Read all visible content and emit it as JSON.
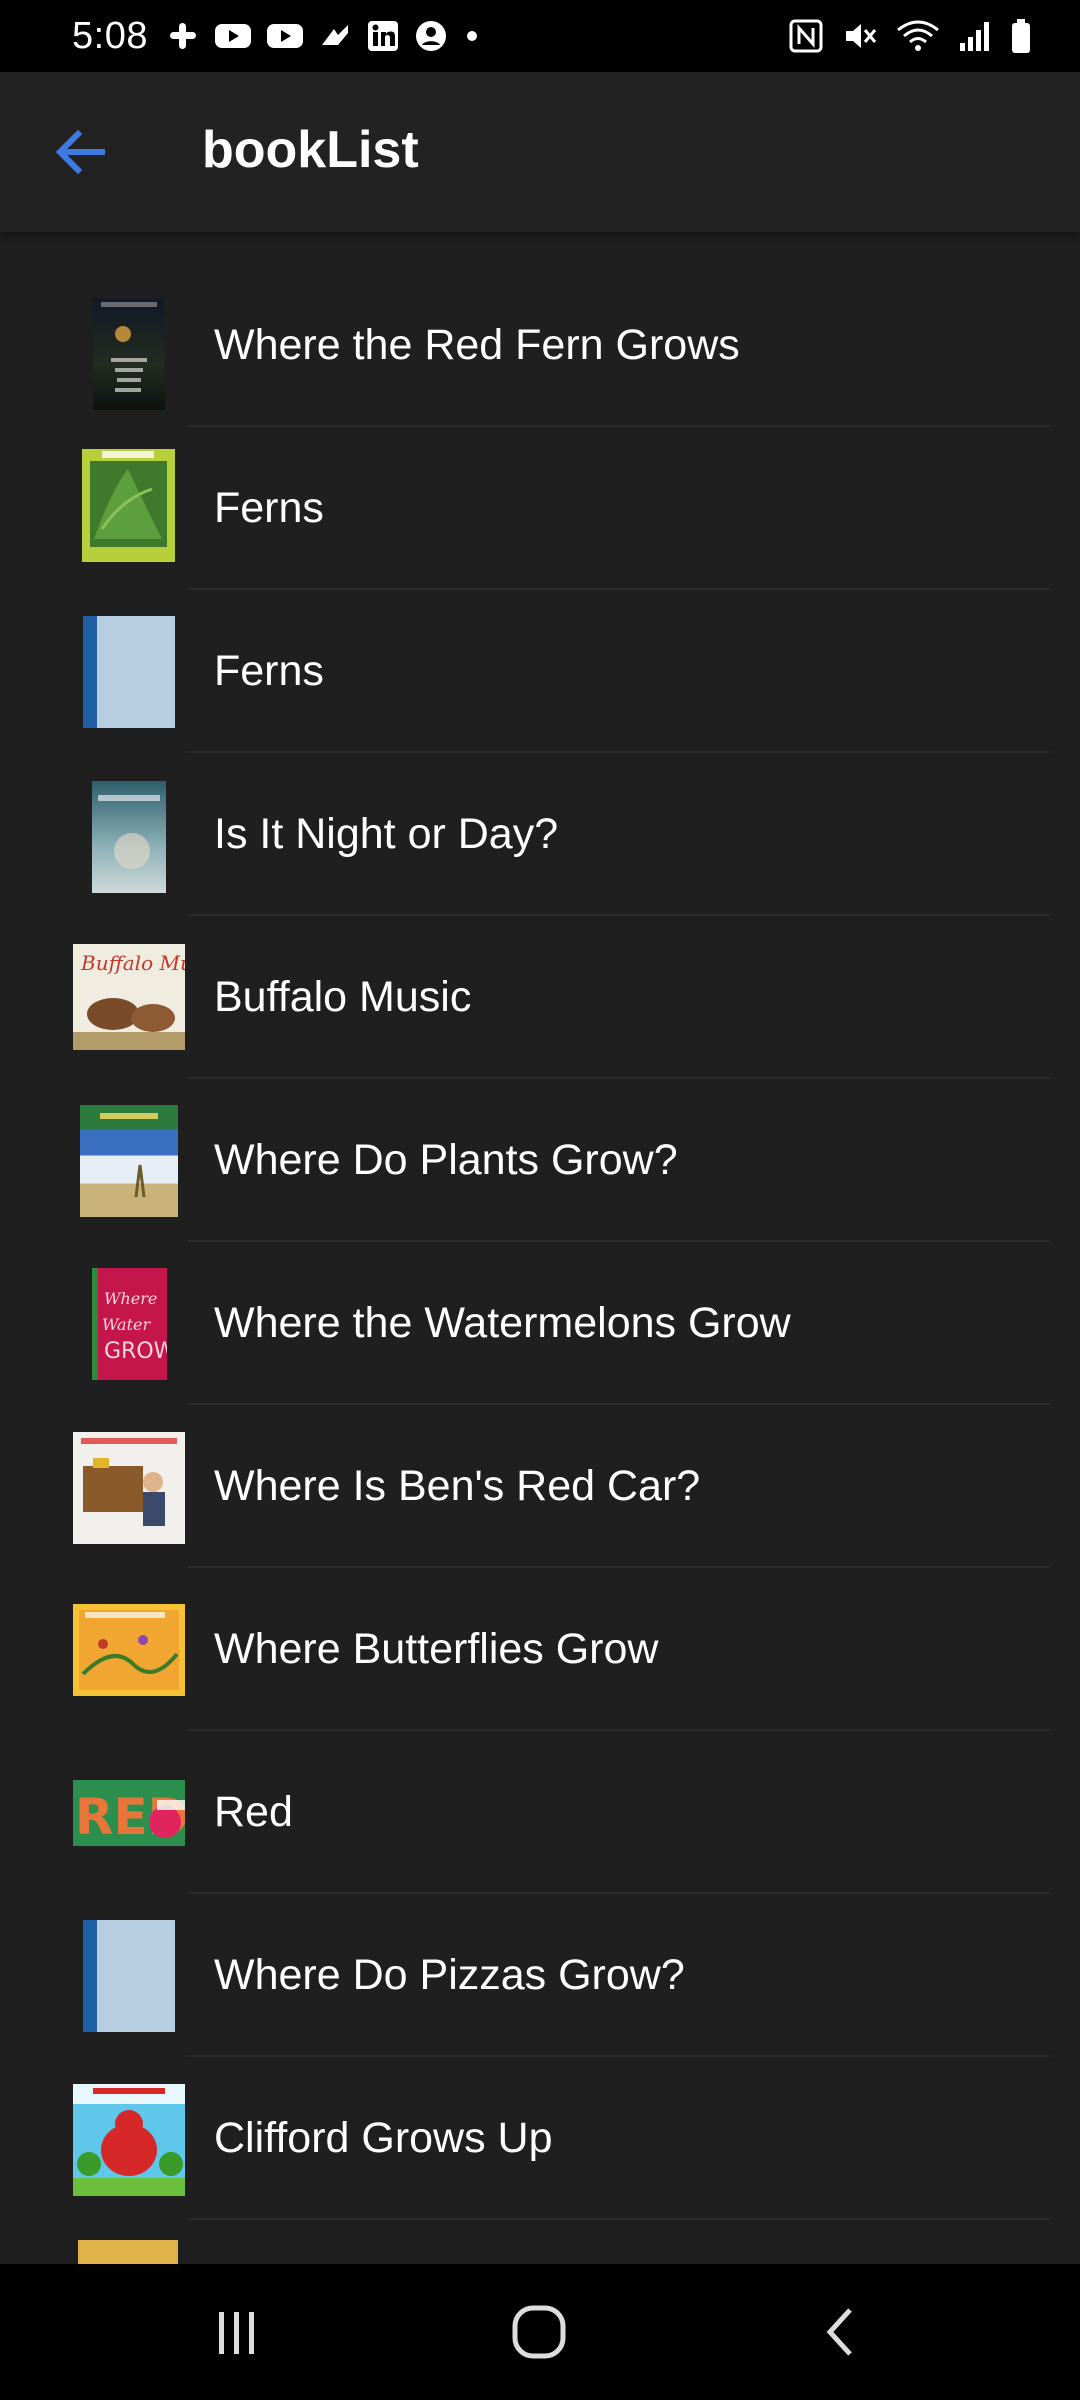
{
  "status_bar": {
    "time": "5:08",
    "left_icons": [
      "slack-icon",
      "youtube-icon",
      "youtube-icon",
      "notification-icon",
      "linkedin-icon",
      "account-icon",
      "dot-icon"
    ],
    "right_icons": [
      "nfc-icon",
      "mute-icon",
      "wifi-icon",
      "signal-icon",
      "battery-icon"
    ]
  },
  "app_bar": {
    "title": "bookList",
    "back_icon": "arrow-left-icon",
    "accent_color": "#3d7be0"
  },
  "books": [
    {
      "title": "Where the Red Fern Grows",
      "cover": "dark night scene cover"
    },
    {
      "title": "Ferns",
      "cover": "green fern leaves cover"
    },
    {
      "title": "Ferns",
      "cover": "placeholder blue cover"
    },
    {
      "title": "Is It Night or Day?",
      "cover": "teal photo cover"
    },
    {
      "title": "Buffalo Music",
      "cover": "illustrated buffalo cover"
    },
    {
      "title": "Where Do Plants Grow?",
      "cover": "beach plants cover"
    },
    {
      "title": "Where the Watermelons Grow",
      "cover": "pink watermelon cover"
    },
    {
      "title": "Where Is Ben's Red Car?",
      "cover": "boy with toy box cover"
    },
    {
      "title": "Where Butterflies Grow",
      "cover": "yellow butterflies cover"
    },
    {
      "title": "Red",
      "cover": "green red crayon cover"
    },
    {
      "title": "Where Do Pizzas Grow?",
      "cover": "placeholder blue cover"
    },
    {
      "title": "Clifford Grows Up",
      "cover": "clifford red dog cover"
    }
  ],
  "nav_bar": {
    "recents_icon": "recents-icon",
    "home_icon": "home-icon",
    "back_icon": "back-chevron-icon"
  }
}
